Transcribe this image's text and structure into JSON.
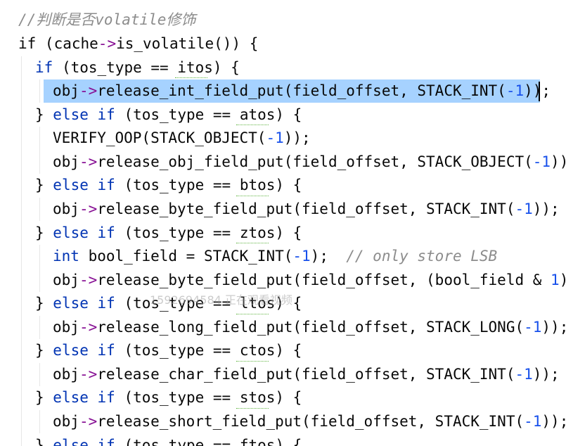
{
  "code": {
    "comment": "//判断是否volatile修饰",
    "lines": [
      [
        {
          "t": "plain",
          "v": "if (cache"
        },
        {
          "t": "arrow",
          "v": "->"
        },
        {
          "t": "plain",
          "v": "is_volatile()) {"
        }
      ],
      [
        {
          "t": "kw",
          "v": "if"
        },
        {
          "t": "plain",
          "v": " (tos_type == itos) {"
        }
      ],
      [
        {
          "t": "plain",
          "v": "obj"
        },
        {
          "t": "arrow",
          "v": "->"
        },
        {
          "t": "plain",
          "v": "release_int_field_put(field_offset, STACK_INT("
        },
        {
          "t": "num",
          "v": "-1"
        },
        {
          "t": "plain",
          "v": "));"
        }
      ],
      [
        {
          "t": "plain",
          "v": "} "
        },
        {
          "t": "kw",
          "v": "else if"
        },
        {
          "t": "plain",
          "v": " (tos_type == atos) {"
        }
      ],
      [
        {
          "t": "plain",
          "v": "VERIFY_OOP(STACK_OBJECT("
        },
        {
          "t": "num",
          "v": "-1"
        },
        {
          "t": "plain",
          "v": "));"
        }
      ],
      [
        {
          "t": "plain",
          "v": "obj"
        },
        {
          "t": "arrow",
          "v": "->"
        },
        {
          "t": "plain",
          "v": "release_obj_field_put(field_offset, STACK_OBJECT("
        },
        {
          "t": "num",
          "v": "-1"
        },
        {
          "t": "plain",
          "v": "));"
        }
      ],
      [
        {
          "t": "plain",
          "v": "} "
        },
        {
          "t": "kw",
          "v": "else if"
        },
        {
          "t": "plain",
          "v": " (tos_type == btos) {"
        }
      ],
      [
        {
          "t": "plain",
          "v": "obj"
        },
        {
          "t": "arrow",
          "v": "->"
        },
        {
          "t": "plain",
          "v": "release_byte_field_put(field_offset, STACK_INT("
        },
        {
          "t": "num",
          "v": "-1"
        },
        {
          "t": "plain",
          "v": "));"
        }
      ],
      [
        {
          "t": "plain",
          "v": "} "
        },
        {
          "t": "kw",
          "v": "else if"
        },
        {
          "t": "plain",
          "v": " (tos_type == ztos) {"
        }
      ],
      [
        {
          "t": "kw",
          "v": "int"
        },
        {
          "t": "plain",
          "v": " bool_field = STACK_INT("
        },
        {
          "t": "num",
          "v": "-1"
        },
        {
          "t": "plain",
          "v": ");  "
        },
        {
          "t": "comment",
          "v": "// only store LSB"
        }
      ],
      [
        {
          "t": "plain",
          "v": "obj"
        },
        {
          "t": "arrow",
          "v": "->"
        },
        {
          "t": "plain",
          "v": "release_byte_field_put(field_offset, (bool_field & "
        },
        {
          "t": "num",
          "v": "1"
        },
        {
          "t": "plain",
          "v": "))"
        }
      ],
      [
        {
          "t": "plain",
          "v": "} "
        },
        {
          "t": "kw",
          "v": "else if"
        },
        {
          "t": "plain",
          "v": " (tos_type == ltos) {"
        }
      ],
      [
        {
          "t": "plain",
          "v": "obj"
        },
        {
          "t": "arrow",
          "v": "->"
        },
        {
          "t": "plain",
          "v": "release_long_field_put(field_offset, STACK_LONG("
        },
        {
          "t": "num",
          "v": "-1"
        },
        {
          "t": "plain",
          "v": "));"
        }
      ],
      [
        {
          "t": "plain",
          "v": "} "
        },
        {
          "t": "kw",
          "v": "else if"
        },
        {
          "t": "plain",
          "v": " (tos_type == ctos) {"
        }
      ],
      [
        {
          "t": "plain",
          "v": "obj"
        },
        {
          "t": "arrow",
          "v": "->"
        },
        {
          "t": "plain",
          "v": "release_char_field_put(field_offset, STACK_INT("
        },
        {
          "t": "num",
          "v": "-1"
        },
        {
          "t": "plain",
          "v": "));"
        }
      ],
      [
        {
          "t": "plain",
          "v": "} "
        },
        {
          "t": "kw",
          "v": "else if"
        },
        {
          "t": "plain",
          "v": " (tos_type == stos) {"
        }
      ],
      [
        {
          "t": "plain",
          "v": "obj"
        },
        {
          "t": "arrow",
          "v": "->"
        },
        {
          "t": "plain",
          "v": "release_short_field_put(field_offset, STACK_INT("
        },
        {
          "t": "num",
          "v": "-1"
        },
        {
          "t": "plain",
          "v": "));"
        }
      ],
      [
        {
          "t": "plain",
          "v": "} "
        },
        {
          "t": "kw",
          "v": "else if"
        },
        {
          "t": "plain",
          "v": " (tos_type == ftos) {"
        }
      ]
    ]
  },
  "watermark": "1592694584 正在观看视频",
  "colors": {
    "keyword": "#0033b3",
    "number": "#1750eb",
    "selection": "#a6d2ff"
  }
}
